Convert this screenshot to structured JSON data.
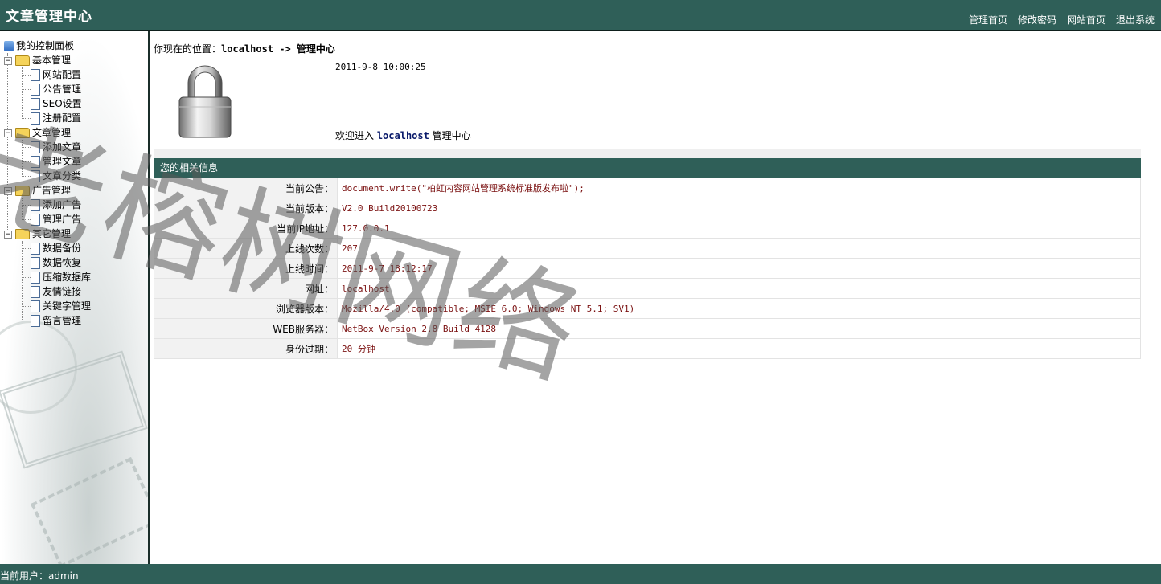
{
  "header": {
    "title": "文章管理中心",
    "nav": [
      "管理首页",
      "修改密码",
      "网站首页",
      "退出系统"
    ]
  },
  "sidebar": {
    "root": "我的控制面板",
    "groups": [
      {
        "label": "基本管理",
        "items": [
          "网站配置",
          "公告管理",
          "SEO设置",
          "注册配置"
        ]
      },
      {
        "label": "文章管理",
        "items": [
          "添加文章",
          "管理文章",
          "文章分类"
        ]
      },
      {
        "label": "广告管理",
        "items": [
          "添加广告",
          "管理广告"
        ]
      },
      {
        "label": "其它管理",
        "items": [
          "数据备份",
          "数据恢复",
          "压缩数据库",
          "友情链接",
          "关键字管理",
          "留言管理"
        ]
      }
    ]
  },
  "main": {
    "breadcrumb_prefix": "你现在的位置：",
    "breadcrumb_path": "localhost -> 管理中心",
    "datetime": "2011-9-8 10:00:25",
    "welcome_prefix": "欢迎进入 ",
    "welcome_site": "localhost",
    "welcome_suffix": " 管理中心",
    "info_header": "您的相关信息",
    "info_rows": [
      {
        "key": "当前公告：",
        "value": "document.write(\"柏虹内容网站管理系统标准版发布啦\");"
      },
      {
        "key": "当前版本：",
        "value": "V2.0 Build20100723"
      },
      {
        "key": "当前IP地址：",
        "value": "127.0.0.1"
      },
      {
        "key": "上线次数：",
        "value": "207"
      },
      {
        "key": "上线时间：",
        "value": "2011-9-7 18:12:17"
      },
      {
        "key": "网址：",
        "value": "localhost"
      },
      {
        "key": "浏览器版本：",
        "value": "Mozilla/4.0 (compatible; MSIE 6.0; Windows NT 5.1; SV1)"
      },
      {
        "key": "WEB服务器：",
        "value": "NetBox Version 2.8 Build 4128"
      },
      {
        "key": "身份过期：",
        "value": "20 分钟"
      }
    ]
  },
  "watermark": "老榕树网络",
  "status": "当前用户：admin",
  "colors": {
    "theme": "#2f5f58",
    "value_text": "#7a1010"
  }
}
